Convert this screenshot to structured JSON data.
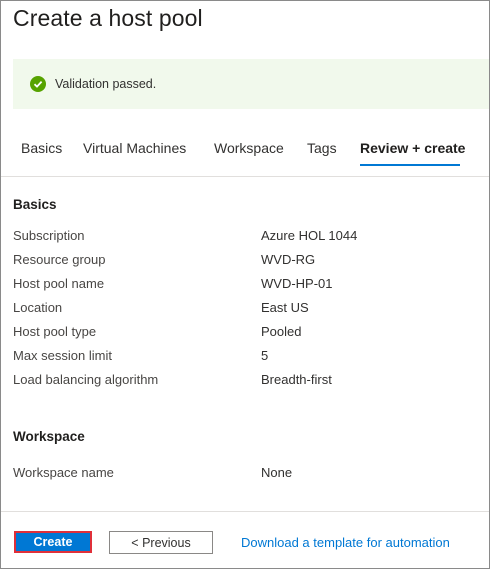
{
  "page": {
    "title": "Create a host pool"
  },
  "banner": {
    "message": "Validation passed."
  },
  "tabs": [
    {
      "label": "Basics"
    },
    {
      "label": "Virtual Machines"
    },
    {
      "label": "Workspace"
    },
    {
      "label": "Tags"
    },
    {
      "label": "Review + create"
    }
  ],
  "basics": {
    "title": "Basics",
    "rows": [
      {
        "label": "Subscription",
        "value": "Azure HOL 1044"
      },
      {
        "label": "Resource group",
        "value": "WVD-RG"
      },
      {
        "label": "Host pool name",
        "value": "WVD-HP-01"
      },
      {
        "label": "Location",
        "value": "East US"
      },
      {
        "label": "Host pool type",
        "value": "Pooled"
      },
      {
        "label": "Max session limit",
        "value": "5"
      },
      {
        "label": "Load balancing algorithm",
        "value": "Breadth-first"
      }
    ]
  },
  "workspace": {
    "title": "Workspace",
    "rows": [
      {
        "label": "Workspace name",
        "value": "None"
      }
    ]
  },
  "footer": {
    "create_label": "Create",
    "previous_label": "< Previous",
    "download_label": "Download a template for automation"
  },
  "colors": {
    "accent": "#0078d4",
    "success": "#57a300",
    "banner_bg": "#f1f9ec",
    "highlight_border": "#e0303a"
  }
}
